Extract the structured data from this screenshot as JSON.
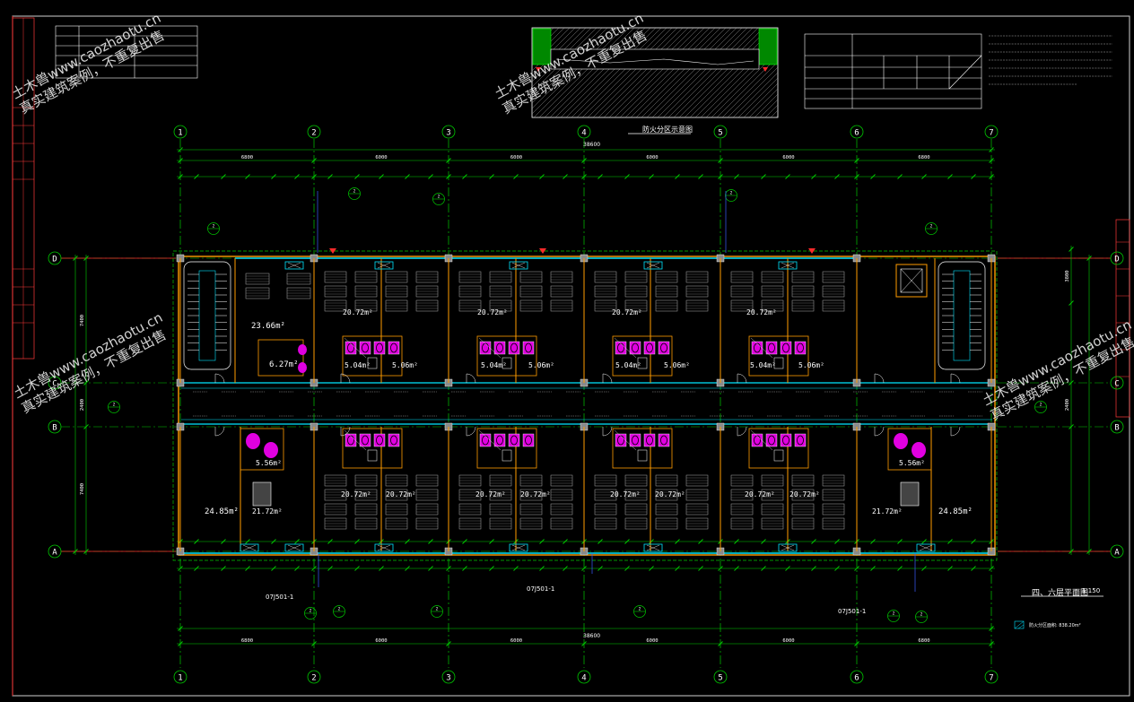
{
  "drawing": {
    "plan_title": "四、六层平面图",
    "plan_scale": "1:150",
    "fire_zone_title": "防火分区示意图",
    "total_length": "38600",
    "bay_dims": [
      "6800",
      "6000",
      "6000",
      "6000",
      "6000",
      "6800"
    ],
    "axes_columns": [
      "1",
      "2",
      "3",
      "4",
      "5",
      "6",
      "7"
    ],
    "axes_rows": [
      "D",
      "C",
      "B",
      "A"
    ],
    "left_dims": [
      "7400",
      "2400",
      "7400",
      "17200"
    ],
    "right_dims": [
      "3800",
      "7400",
      "2400",
      "7400",
      "17200"
    ],
    "room_areas": {
      "top_left_lobby": "23.66m²",
      "top_left_wc": "6.27m²",
      "wc_small": "5.06m²",
      "wc_small_alt": "5.04m²",
      "bed_room": "20.72m²",
      "bottom_left_room": "24.85m²",
      "bottom_left_room2": "21.72m²",
      "bottom_left_wc": "5.56m²",
      "bottom_right_room": "24.85m²",
      "bottom_right_room2": "21.72m²",
      "bottom_right_wc": "5.56m²"
    },
    "detail_ref": "07J501-1",
    "legend_text": "防火分区面积: 838.20m²"
  },
  "watermarks": [
    {
      "line1": "土木兽www.caozhaotu.cn",
      "line2": "真实建筑案例，不重复出售"
    },
    {
      "line1": "土木兽www.caozhaotu.cn",
      "line2": "真实建筑案例，不重复出售"
    },
    {
      "line1": "土木兽www.caozhaotu.cn",
      "line2": "真实建筑案例，不重复出售"
    },
    {
      "line1": "土木兽www.caozhaotu.cn",
      "line2": "真实建筑案例，不重复出售"
    }
  ],
  "colors": {
    "axis": "#00c800",
    "wall": "#ff9c00",
    "glass": "#00e5ff",
    "fixture": "#e000e0",
    "furniture": "#b0b0b0",
    "dim": "#00d000",
    "bg": "#000000"
  }
}
